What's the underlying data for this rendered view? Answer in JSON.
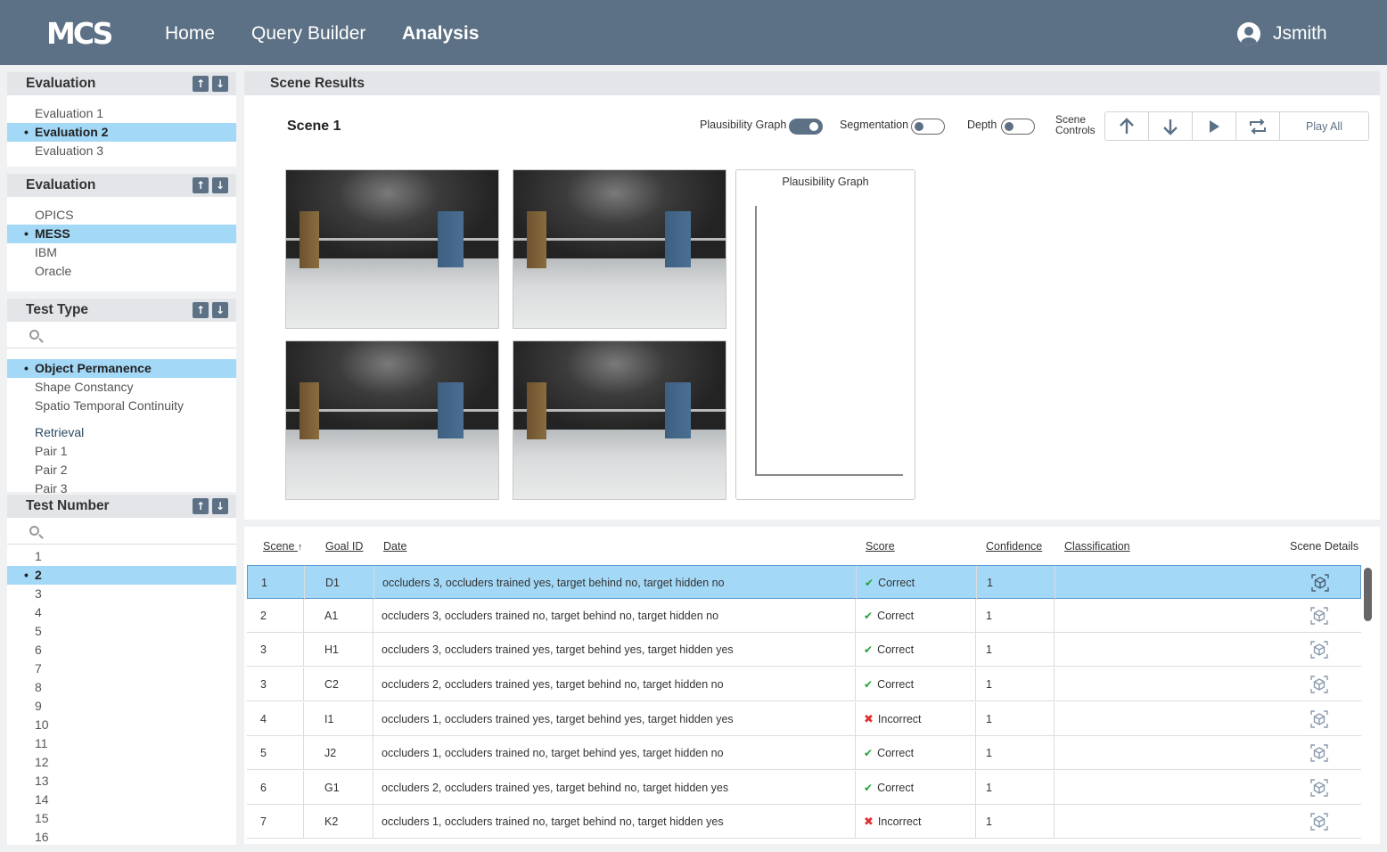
{
  "header": {
    "logo": "MCS",
    "nav": [
      "Home",
      "Query Builder",
      "Analysis"
    ],
    "active_nav": "Analysis",
    "user": "Jsmith"
  },
  "sidebar": {
    "evaluation": {
      "title": "Evaluation",
      "items": [
        "Evaluation 1",
        "Evaluation 2",
        "Evaluation 3"
      ],
      "selected": "Evaluation 2"
    },
    "performer": {
      "title": "Evaluation",
      "items": [
        "OPICS",
        "MESS",
        "IBM",
        "Oracle"
      ],
      "selected": "MESS"
    },
    "test_type": {
      "title": "Test Type",
      "search_placeholder": "",
      "items": [
        "Object Permanence",
        "Shape Constancy",
        "Spatio Temporal Continuity"
      ],
      "selected": "Object Permanence",
      "sub_heading": "Retrieval",
      "sub_items": [
        "Pair 1",
        "Pair 2",
        "Pair 3"
      ]
    },
    "test_number": {
      "title": "Test Number",
      "search_placeholder": "",
      "items": [
        "1",
        "2",
        "3",
        "4",
        "5",
        "6",
        "7",
        "8",
        "9",
        "10",
        "11",
        "12",
        "13",
        "14",
        "15",
        "16"
      ],
      "selected": "2"
    }
  },
  "scene_results": {
    "title": "Scene Results",
    "scene_title": "Scene 1",
    "toggles": [
      {
        "label": "Plausibility Graph",
        "on": true
      },
      {
        "label": "Segmentation",
        "on": false
      },
      {
        "label": "Depth",
        "on": false
      }
    ],
    "controls_label_1": "Scene",
    "controls_label_2": "Controls",
    "controls": [
      "arrow-up-icon",
      "arrow-down-icon",
      "play-icon",
      "repeat-icon"
    ],
    "play_all": "Play All",
    "graph_title": "Plausibility Graph"
  },
  "table": {
    "columns": [
      "Scene",
      "Goal ID",
      "Date",
      "Score",
      "Confidence",
      "Classification",
      "Scene Details"
    ],
    "sort_indicator": "↑",
    "rows": [
      {
        "scene": "1",
        "goal": "D1",
        "desc": "occluders 3, occluders trained yes, target behind no, target hidden no",
        "score": "Correct",
        "correct": true,
        "conf": "1",
        "cls": ""
      },
      {
        "scene": "2",
        "goal": "A1",
        "desc": "occluders 3, occluders trained no, target behind no, target hidden no",
        "score": "Correct",
        "correct": true,
        "conf": "1",
        "cls": ""
      },
      {
        "scene": "3",
        "goal": "H1",
        "desc": "occluders 3, occluders trained yes, target behind yes, target hidden yes",
        "score": "Correct",
        "correct": true,
        "conf": "1",
        "cls": ""
      },
      {
        "scene": "3",
        "goal": "C2",
        "desc": "occluders 2, occluders trained yes, target behind no, target hidden no",
        "score": "Correct",
        "correct": true,
        "conf": "1",
        "cls": ""
      },
      {
        "scene": "4",
        "goal": "I1",
        "desc": "occluders 1, occluders trained yes, target behind yes, target hidden yes",
        "score": "Incorrect",
        "correct": false,
        "conf": "1",
        "cls": ""
      },
      {
        "scene": "5",
        "goal": "J2",
        "desc": "occluders 1, occluders trained no, target behind yes, target hidden no",
        "score": "Correct",
        "correct": true,
        "conf": "1",
        "cls": ""
      },
      {
        "scene": "6",
        "goal": "G1",
        "desc": "occluders 2, occluders trained yes, target behind no, target hidden yes",
        "score": "Correct",
        "correct": true,
        "conf": "1",
        "cls": ""
      },
      {
        "scene": "7",
        "goal": "K2",
        "desc": "occluders 1, occluders trained no, target behind no, target hidden yes",
        "score": "Incorrect",
        "correct": false,
        "conf": "1",
        "cls": ""
      }
    ],
    "selected_row": 0
  }
}
